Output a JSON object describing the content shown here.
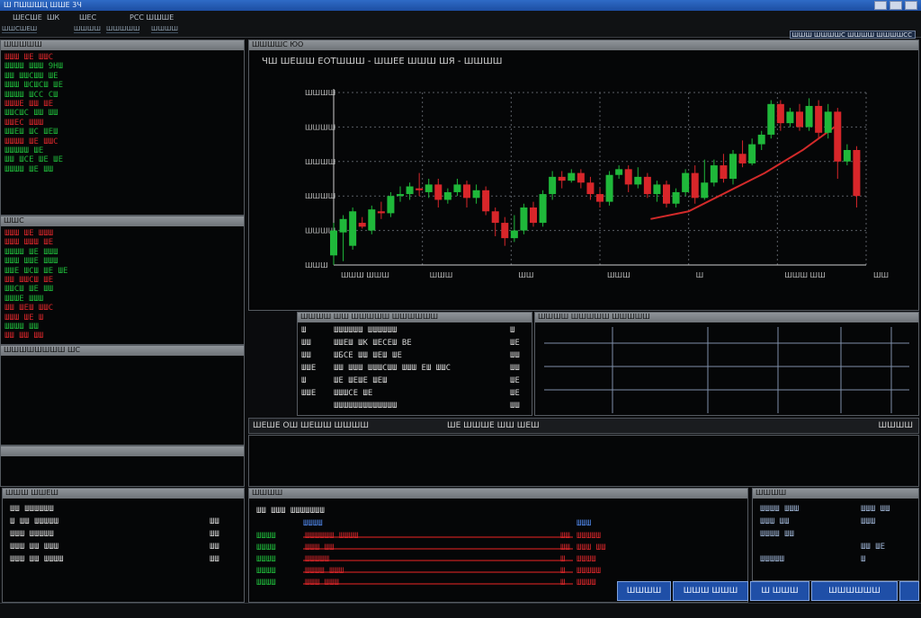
{
  "window": {
    "title": "Ш ПШШШЦ ШШЕ 3Ч"
  },
  "menu": {
    "items": [
      "ШЕСШЕ",
      "ШК",
      "ШЕС",
      "РСС ШШШЕ"
    ],
    "toolbar": [
      "ШШСШЕШ",
      "ШШШШ",
      "ШШШШШ",
      "ШШШШ"
    ],
    "clock": "ШШШ ШШШШС ШШШШ ШШШШСС"
  },
  "colors": {
    "up": "#1fb83a",
    "down": "#d8262a",
    "accent": "#1f4fa7"
  },
  "left_panels": [
    {
      "header": "ШШШШШ",
      "rows": [
        {
          "text": "ШШШ ШЕ ШШС",
          "color": "r"
        },
        {
          "text": "ШШШШ ШШШ 9НШ",
          "color": "g"
        },
        {
          "text": "ШШ ШШСШШ ШЕ",
          "color": "g"
        },
        {
          "text": "ШШШ ШСШСШ ШЕ",
          "color": "g"
        },
        {
          "text": "ШШШШ ШСС СШ",
          "color": "g"
        },
        {
          "text": "ШШШЕ ШШ ШЕ",
          "color": "r"
        },
        {
          "text": "ШШСШС ШШ ШШ",
          "color": "g"
        },
        {
          "text": "ШШЕС ШШШ",
          "color": "r"
        },
        {
          "text": "ШШЕШ ШС ШЕШ",
          "color": "g"
        },
        {
          "text": "ШШШШ ШЕ ШШС",
          "color": "r"
        },
        {
          "text": "ШШШШШ ШЕ",
          "color": "g"
        },
        {
          "text": "ШШ ШСЕ ШЕ ШЕ",
          "color": "g"
        },
        {
          "text": "ШШШШ ШЕ ШШ",
          "color": "g"
        }
      ]
    },
    {
      "header": "ШШС",
      "rows": [
        {
          "text": "ШШШ ШЕ ШШШ",
          "color": "r"
        },
        {
          "text": "ШШШ ШШШ ШЕ",
          "color": "r"
        },
        {
          "text": "ШШШШ ШЕ ШШШ",
          "color": "g"
        },
        {
          "text": "ШШШ ШШЕ ШШШ",
          "color": "g"
        },
        {
          "text": "ШШЕ ШСШ ШЕ ШЕ",
          "color": "g"
        },
        {
          "text": "ШШ ШШСШ ШЕ",
          "color": "r"
        },
        {
          "text": "ШШСШ ШЕ ШШ",
          "color": "g"
        },
        {
          "text": "ШШШЕ ШШШ",
          "color": "g"
        },
        {
          "text": "ШШ ШЕШ ШШС",
          "color": "r"
        },
        {
          "text": "ШШШ ШЕ Ш",
          "color": "r"
        },
        {
          "text": "ШШШШ ШШ",
          "color": "g"
        },
        {
          "text": "ШШ ШШ ШШ",
          "color": "r"
        }
      ]
    },
    {
      "header": "ШШШШШШШШ ШС"
    },
    {
      "header": ""
    }
  ],
  "chart_panel": {
    "header": "ШШШШС ЮО",
    "title": "ЧШ ШЕШШ ЕОТШШШ - ШШЕЕ ШШШ ШЯ - ШШШШ"
  },
  "chart_data": {
    "type": "candlestick",
    "y_tick_labels": [
      "ШШШШ",
      "ШШШШ",
      "ШШШШ",
      "ШШШШ",
      "ШШШШ",
      "ШШШ"
    ],
    "x_tick_labels": [
      "ШШШ ШШШ",
      "ШШШ",
      "ШШ",
      "ШШШ",
      "Ш",
      "ШШШ ШШ",
      "ШШ"
    ],
    "grid": true,
    "candles": [
      [
        0,
        5,
        18,
        0,
        22
      ],
      [
        3,
        17,
        24,
        2,
        26
      ],
      [
        6,
        10,
        28,
        8,
        30
      ],
      [
        9,
        22,
        20,
        19,
        25
      ],
      [
        12,
        18,
        29,
        16,
        31
      ],
      [
        15,
        28,
        27,
        24,
        33
      ],
      [
        18,
        27,
        36,
        25,
        38
      ],
      [
        21,
        36,
        37,
        33,
        41
      ],
      [
        24,
        37,
        41,
        34,
        43
      ],
      [
        27,
        40,
        39,
        36,
        48
      ],
      [
        30,
        38,
        42,
        35,
        45
      ],
      [
        33,
        42,
        34,
        30,
        45
      ],
      [
        36,
        34,
        38,
        32,
        40
      ],
      [
        39,
        38,
        42,
        36,
        45
      ],
      [
        42,
        42,
        35,
        30,
        44
      ],
      [
        45,
        35,
        39,
        32,
        42
      ],
      [
        48,
        39,
        28,
        26,
        41
      ],
      [
        51,
        28,
        22,
        15,
        30
      ],
      [
        54,
        22,
        14,
        10,
        25
      ],
      [
        57,
        14,
        18,
        12,
        26
      ],
      [
        60,
        18,
        30,
        16,
        32
      ],
      [
        63,
        30,
        22,
        20,
        33
      ],
      [
        66,
        22,
        37,
        20,
        39
      ],
      [
        69,
        37,
        46,
        34,
        49
      ],
      [
        72,
        46,
        44,
        40,
        49
      ],
      [
        75,
        44,
        48,
        43,
        50
      ],
      [
        78,
        48,
        43,
        40,
        50
      ],
      [
        81,
        43,
        37,
        34,
        46
      ],
      [
        84,
        37,
        33,
        30,
        40
      ],
      [
        87,
        33,
        47,
        31,
        49
      ],
      [
        90,
        47,
        50,
        45,
        52
      ],
      [
        93,
        50,
        42,
        38,
        52
      ],
      [
        96,
        42,
        46,
        40,
        51
      ],
      [
        99,
        46,
        37,
        35,
        48
      ],
      [
        102,
        37,
        42,
        33,
        44
      ],
      [
        105,
        42,
        32,
        30,
        44
      ],
      [
        108,
        32,
        38,
        30,
        40
      ],
      [
        111,
        38,
        48,
        36,
        50
      ],
      [
        114,
        48,
        35,
        32,
        52
      ],
      [
        117,
        35,
        43,
        34,
        55
      ],
      [
        120,
        43,
        52,
        41,
        55
      ],
      [
        123,
        52,
        45,
        43,
        58
      ],
      [
        126,
        45,
        58,
        42,
        60
      ],
      [
        129,
        58,
        53,
        51,
        65
      ],
      [
        132,
        53,
        63,
        52,
        66
      ],
      [
        135,
        63,
        68,
        60,
        70
      ],
      [
        138,
        68,
        84,
        66,
        86
      ],
      [
        141,
        84,
        74,
        70,
        86
      ],
      [
        144,
        74,
        80,
        72,
        82
      ],
      [
        147,
        80,
        72,
        70,
        84
      ],
      [
        150,
        72,
        83,
        70,
        87
      ],
      [
        153,
        83,
        69,
        66,
        86
      ],
      [
        156,
        69,
        80,
        66,
        84
      ],
      [
        159,
        80,
        54,
        45,
        82
      ],
      [
        162,
        54,
        60,
        52,
        63
      ],
      [
        165,
        60,
        36,
        30,
        62
      ]
    ],
    "trend_line": [
      [
        100,
        24
      ],
      [
        112,
        28
      ],
      [
        124,
        38
      ],
      [
        136,
        48
      ],
      [
        148,
        60
      ],
      [
        158,
        72
      ]
    ]
  },
  "order_panel": {
    "header": "ШШШШ ШШ ШШШШШ  ШШШШШШ",
    "rows": [
      {
        "label": "Ш",
        "desc": "ШШШШШШ ШШШШШШ",
        "value": "Ш"
      },
      {
        "label": "ШШ",
        "desc": "ШШЕШ ШК ШЕСЕШ ВЕ",
        "value": "ШЕ"
      },
      {
        "label": "ШШ",
        "desc": "ШБСЕ ШШ ШЕШ ШЕ",
        "value": "ШШ"
      },
      {
        "label": "ШШЕ",
        "desc": "ШШ ШШШ ШШШСШШ  ШШШ ЕШ ШШС",
        "value": "ШШ"
      },
      {
        "label": "Ш",
        "desc": "ШЕ ШЕШЕ ШЕШ",
        "value": "ШЕ"
      },
      {
        "label": "ШШЕ",
        "desc": "ШШШСЕ ШЕ",
        "value": "ШЕ"
      },
      {
        "label": "",
        "desc": "ШШШШШШШШШШШШШ",
        "value": "ШШ"
      }
    ]
  },
  "depth_panel": {
    "header": "ШШШШ ШШШШШ ШШШШШ"
  },
  "tabs": {
    "left": "ШЕШЕ ОШ  ШЕШШ ШШШШ",
    "right": "ШЕ ШШШЕ ШШ ШЕШ",
    "far_right": "ШШШШ"
  },
  "trades_panel": {
    "header": "ШШШШ",
    "subheader": "ШШ ШШШ  ШШШШШШШ",
    "col_headers": [
      "ШШШШ",
      "ШШШ"
    ],
    "rows": [
      [
        "ШШШШ",
        "ШШШШШШ ШШШШ",
        "ШШ",
        "ШШШШШ"
      ],
      [
        "ШШШШ",
        "ШШШ ШШ",
        "ШШ",
        "ШШШ ШШ"
      ],
      [
        "ШШШШ",
        "ШШШШШ",
        "Ш",
        "ШШШШ"
      ],
      [
        "ШШШШ",
        "ШШШШ ШШШ",
        "Ш",
        "ШШШШШ"
      ],
      [
        "ШШШШ",
        "ШШШ ШШШ",
        "Ш",
        "ШШШШ"
      ]
    ]
  },
  "right_bottom_panel": {
    "header": "ШШШШ",
    "rows": [
      [
        "ШШШШ ШШШ",
        "ШШШ ШШ"
      ],
      [
        "ШШШ ШШ",
        "ШШШ"
      ],
      [
        "ШШШШ ШШ",
        ""
      ],
      [
        "",
        "ШШ ШЕ"
      ],
      [
        "ШШШШШ",
        "Ш"
      ]
    ]
  },
  "left_bottom_panel": {
    "header": "ШШШ ШШЕШ",
    "rows": [
      [
        "ШШ ШШШШШШ",
        ""
      ],
      [
        "Ш ШШ ШШШШШ",
        "ШШ"
      ],
      [
        "ШШШ ШШШШШ",
        "ШШ"
      ],
      [
        "ШШШ ШШ ШШШ",
        "ШШ"
      ],
      [
        "ШШШ ШШ ШШШШ",
        "ШШ"
      ]
    ]
  },
  "taskbar": {
    "buttons": [
      "ШШШШ",
      "ШШШ ШШШ",
      "Ш ШШШ",
      "ШШШШШШ"
    ]
  }
}
